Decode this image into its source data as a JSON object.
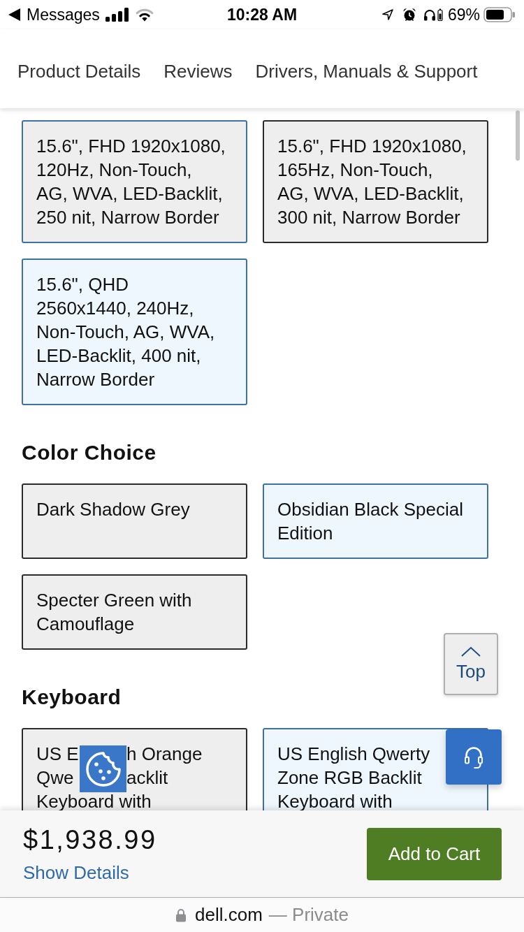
{
  "status_bar": {
    "back_label": "Messages",
    "time": "10:28 AM",
    "battery_percent": "69%"
  },
  "tabs": [
    {
      "label": "Product Details"
    },
    {
      "label": "Reviews"
    },
    {
      "label": "Drivers, Manuals & Support"
    }
  ],
  "sections": [
    {
      "options": [
        {
          "label": "15.6\", FHD 1920x1080,\n120Hz, Non-Touch,\nAG, WVA, LED-Backlit,\n250 nit, Narrow Border",
          "selected": false,
          "outlined": true
        },
        {
          "label": "15.6\", FHD 1920x1080,\n165Hz, Non-Touch,\nAG, WVA, LED-Backlit,\n300 nit, Narrow Border",
          "selected": false,
          "outlined": false
        },
        {
          "label": "15.6\", QHD\n2560x1440, 240Hz,\nNon-Touch, AG, WVA,\nLED-Backlit, 400 nit,\nNarrow Border",
          "selected": true,
          "outlined": true
        }
      ]
    },
    {
      "heading": "Color Choice",
      "options": [
        {
          "label": "Dark Shadow Grey",
          "selected": false,
          "outlined": false
        },
        {
          "label": "Obsidian Black Special\nEdition",
          "selected": true,
          "outlined": true
        },
        {
          "label": "Specter Green with\nCamouflage",
          "selected": false,
          "outlined": false
        }
      ]
    },
    {
      "heading": "Keyboard",
      "options": [
        {
          "label_parts": [
            [
              "US E",
              "h Orange"
            ],
            [
              "Qwe",
              "acklit"
            ],
            [
              "Keyboard with"
            ]
          ],
          "selected": false,
          "outlined": false
        },
        {
          "label": "US English Qwerty\nZone RGB Backlit\nKeyboard with",
          "selected": true,
          "outlined": true
        }
      ]
    }
  ],
  "top_button": {
    "label": "Top"
  },
  "footer": {
    "price": "$1,938.99",
    "details_link": "Show Details",
    "add_to_cart": "Add to Cart"
  },
  "browser_bar": {
    "domain": "dell.com",
    "privacy": "— Private"
  }
}
